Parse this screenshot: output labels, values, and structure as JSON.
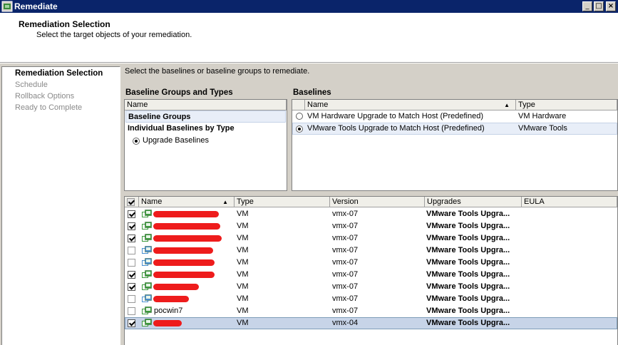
{
  "window": {
    "title": "Remediate",
    "controls": {
      "minimize": "_",
      "maximize": "□",
      "close": "×"
    }
  },
  "header": {
    "title": "Remediation Selection",
    "subtitle": "Select the target objects of your remediation."
  },
  "steps": [
    {
      "label": "Remediation Selection",
      "active": true
    },
    {
      "label": "Schedule",
      "active": false
    },
    {
      "label": "Rollback Options",
      "active": false
    },
    {
      "label": "Ready to Complete",
      "active": false
    }
  ],
  "instructions": "Select the baselines or baseline groups to remediate.",
  "baseline_groups": {
    "title": "Baseline Groups and Types",
    "column_name": "Name",
    "group_item": "Baseline Groups",
    "individual_heading": "Individual Baselines by Type",
    "option": "Upgrade Baselines"
  },
  "baselines": {
    "title": "Baselines",
    "columns": {
      "name": "Name",
      "type": "Type"
    },
    "rows": [
      {
        "name": "VM Hardware Upgrade to Match Host (Predefined)",
        "type": "VM Hardware",
        "selected": false
      },
      {
        "name": "VMware Tools Upgrade to Match Host (Predefined)",
        "type": "VMware Tools",
        "selected": true
      }
    ]
  },
  "targets": {
    "columns": {
      "name": "Name",
      "type": "Type",
      "version": "Version",
      "upgrades": "Upgrades",
      "eula": "EULA"
    },
    "rows": [
      {
        "checked": true,
        "name": "",
        "type": "VM",
        "version": "vmx-07",
        "upgrades": "VMware Tools Upgra...",
        "eula": ""
      },
      {
        "checked": true,
        "name": "",
        "type": "VM",
        "version": "vmx-07",
        "upgrades": "VMware Tools Upgra...",
        "eula": ""
      },
      {
        "checked": true,
        "name": "",
        "type": "VM",
        "version": "vmx-07",
        "upgrades": "VMware Tools Upgra...",
        "eula": ""
      },
      {
        "checked": false,
        "name": "",
        "type": "VM",
        "version": "vmx-07",
        "upgrades": "VMware Tools Upgra...",
        "eula": ""
      },
      {
        "checked": false,
        "name": "",
        "type": "VM",
        "version": "vmx-07",
        "upgrades": "VMware Tools Upgra...",
        "eula": ""
      },
      {
        "checked": true,
        "name": "",
        "type": "VM",
        "version": "vmx-07",
        "upgrades": "VMware Tools Upgra...",
        "eula": ""
      },
      {
        "checked": true,
        "name": "",
        "type": "VM",
        "version": "vmx-07",
        "upgrades": "VMware Tools Upgra...",
        "eula": ""
      },
      {
        "checked": false,
        "name": "",
        "type": "VM",
        "version": "vmx-07",
        "upgrades": "VMware Tools Upgra...",
        "eula": ""
      },
      {
        "checked": false,
        "name": "pocwin7",
        "type": "VM",
        "version": "vmx-07",
        "upgrades": "VMware Tools Upgra...",
        "eula": ""
      },
      {
        "checked": true,
        "name": "",
        "type": "VM",
        "version": "vmx-04",
        "upgrades": "VMware Tools Upgra...",
        "eula": ""
      }
    ]
  },
  "colors": {
    "titlebar": "#0a246a",
    "redaction": "#ee1c1c",
    "selection": "#c7d4e8"
  }
}
